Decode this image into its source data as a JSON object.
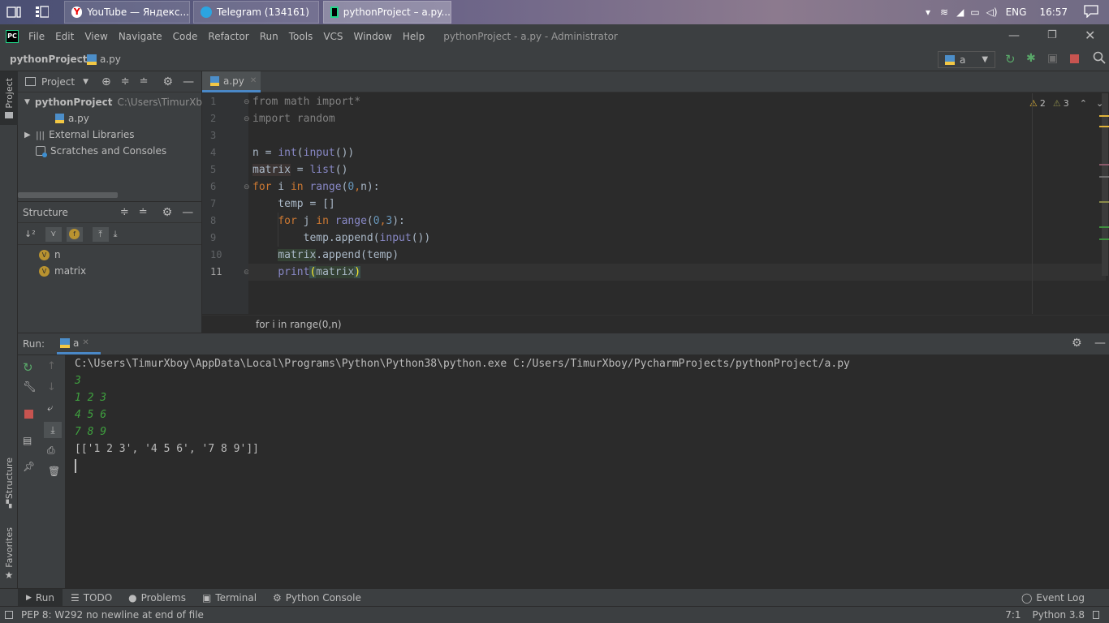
{
  "taskbar": {
    "tabs": [
      {
        "label": "YouTube — Яндекс...",
        "icon": "yandex-icon"
      },
      {
        "label": "Telegram (134161)",
        "icon": "telegram-icon"
      },
      {
        "label": "pythonProject – a.py...",
        "icon": "pycharm-icon"
      }
    ],
    "lang": "ENG",
    "time": "16:57"
  },
  "menu": {
    "items": [
      "File",
      "Edit",
      "View",
      "Navigate",
      "Code",
      "Refactor",
      "Run",
      "Tools",
      "VCS",
      "Window",
      "Help"
    ],
    "window_title": "pythonProject - a.py - Administrator"
  },
  "nav": {
    "project": "pythonProject",
    "file": "a.py",
    "run_config": "a"
  },
  "left_strip": {
    "project_label": "Project",
    "structure_label": "Structure",
    "favorites_label": "Favorites"
  },
  "project_panel": {
    "title": "Project",
    "root_name": "pythonProject",
    "root_path": "C:\\Users\\TimurXbo",
    "file": "a.py",
    "external_libs": "External Libraries",
    "scratches": "Scratches and Consoles"
  },
  "structure_panel": {
    "title": "Structure",
    "items": [
      "n",
      "matrix"
    ],
    "badge": "V"
  },
  "editor": {
    "tab_label": "a.py",
    "warnings": "2",
    "weak_warnings": "3",
    "breadcrumb": "for i in range(0,n)",
    "line_numbers": [
      "1",
      "2",
      "3",
      "4",
      "5",
      "6",
      "7",
      "8",
      "9",
      "10",
      "11"
    ]
  },
  "run_panel": {
    "label": "Run:",
    "tab": "a",
    "command": "C:\\Users\\TimurXboy\\AppData\\Local\\Programs\\Python\\Python38\\python.exe C:/Users/TimurXboy/PycharmProjects/pythonProject/a.py",
    "inputs": [
      "3",
      "1 2 3",
      "4 5 6",
      "7 8 9"
    ],
    "result": "[['1 2 3', '4 5 6', '7 8 9']]"
  },
  "bottom_tabs": {
    "run": "Run",
    "todo": "TODO",
    "problems": "Problems",
    "terminal": "Terminal",
    "python_console": "Python Console",
    "event_log": "Event Log"
  },
  "status": {
    "message": "PEP 8: W292 no newline at end of file",
    "position": "7:1",
    "interpreter": "Python 3.8"
  },
  "colors": {
    "keyword": "#cc7832",
    "builtin": "#8888c6",
    "number": "#6897bb",
    "input_green": "#3fa23f",
    "pycharm_green": "#21d789"
  }
}
